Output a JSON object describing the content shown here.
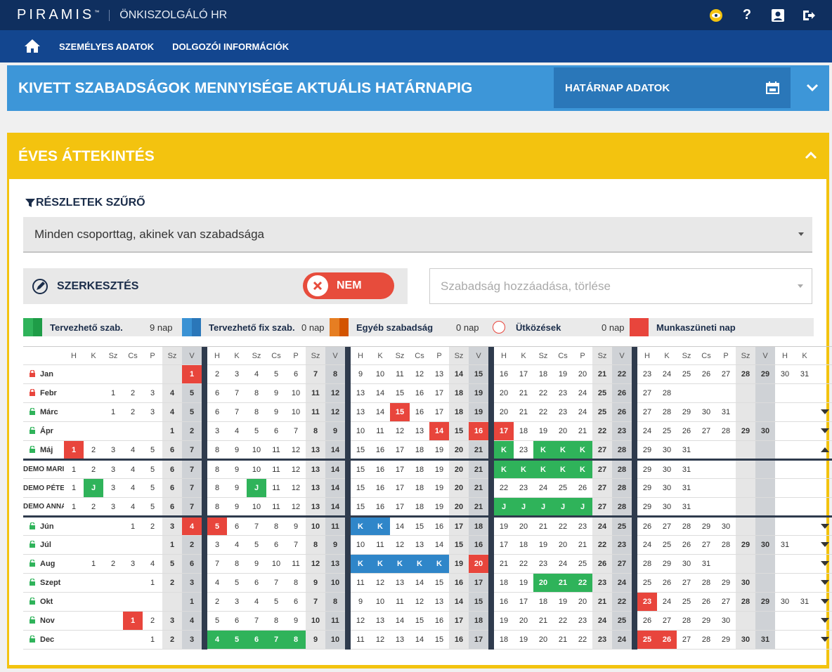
{
  "header": {
    "logo": "PIRAMIS",
    "logo_tm": "™",
    "app_name": "ÖNKISZOLGÁLÓ HR"
  },
  "nav": {
    "items": [
      "SZEMÉLYES ADATOK",
      "DOLGOZÓI INFORMÁCIÓK"
    ]
  },
  "panel1": {
    "title": "KIVETT SZABADSÁGOK MENNYISÉGE AKTUÁLIS HATÁRNAPIG",
    "button": "HATÁRNAP ADATOK"
  },
  "panel2": {
    "title": "ÉVES ÁTTEKINTÉS",
    "filter_title": "RÉSZLETEK SZŰRŐ",
    "filter_value": "Minden csoporttag, akinek van szabadsága",
    "edit_label": "SZERKESZTÉS",
    "toggle_label": "NEM",
    "add_placeholder": "Szabadság hozzáadása, törlése"
  },
  "colors": {
    "green": "#2fb35a",
    "blue": "#2f86c9",
    "orange": "#e67e22",
    "red": "#e8453c"
  },
  "legend": [
    {
      "label": "Tervezhető szab.",
      "count": "9 nap",
      "colors": [
        "#2fb35a",
        "#1e9c47"
      ]
    },
    {
      "label": "Tervezhető fix szab.",
      "count": "0 nap",
      "colors": [
        "#3a92d4",
        "#2a77b9"
      ]
    },
    {
      "label": "Egyéb szabadság",
      "count": "0 nap",
      "colors": [
        "#e67e22",
        "#d35400"
      ]
    },
    {
      "label": "Ütközések",
      "count": "0 nap",
      "type": "circle"
    },
    {
      "label": "Munkaszüneti nap",
      "count": "",
      "colors": [
        "#e8453c",
        "#e8453c"
      ]
    }
  ],
  "day_headers": [
    "H",
    "K",
    "Sz",
    "Cs",
    "P",
    "Sz",
    "V",
    "H",
    "K",
    "Sz",
    "Cs",
    "P",
    "Sz",
    "V",
    "H",
    "K",
    "Sz",
    "Cs",
    "P",
    "Sz",
    "V",
    "H",
    "K",
    "Sz",
    "Cs",
    "P",
    "Sz",
    "V",
    "H",
    "K",
    "Sz",
    "Cs",
    "P",
    "Sz",
    "V",
    "H",
    "K"
  ],
  "rows": [
    {
      "label": "Jan",
      "lock": "closed",
      "action": "",
      "cells": [
        "",
        "",
        "",
        "",
        "",
        "",
        "1",
        "2",
        "3",
        "4",
        "5",
        "6",
        "7",
        "8",
        "9",
        "10",
        "11",
        "12",
        "13",
        "14",
        "15",
        "16",
        "17",
        "18",
        "19",
        "20",
        "21",
        "22",
        "23",
        "24",
        "25",
        "26",
        "27",
        "28",
        "29",
        "30",
        "31"
      ],
      "special": {
        "6": "red"
      }
    },
    {
      "label": "Febr",
      "lock": "closed",
      "action": "",
      "cells": [
        "",
        "",
        "1",
        "2",
        "3",
        "4",
        "5",
        "6",
        "7",
        "8",
        "9",
        "10",
        "11",
        "12",
        "13",
        "14",
        "15",
        "16",
        "17",
        "18",
        "19",
        "20",
        "21",
        "22",
        "23",
        "24",
        "25",
        "26",
        "27",
        "28",
        "",
        "",
        "",
        "",
        "",
        "",
        ""
      ],
      "special": {}
    },
    {
      "label": "Márc",
      "lock": "open",
      "action": "down",
      "cells": [
        "",
        "",
        "1",
        "2",
        "3",
        "4",
        "5",
        "6",
        "7",
        "8",
        "9",
        "10",
        "11",
        "12",
        "13",
        "14",
        "15",
        "16",
        "17",
        "18",
        "19",
        "20",
        "21",
        "22",
        "23",
        "24",
        "25",
        "26",
        "27",
        "28",
        "29",
        "30",
        "31",
        "",
        "",
        "",
        ""
      ],
      "special": {
        "16": "red"
      }
    },
    {
      "label": "Ápr",
      "lock": "open",
      "action": "down",
      "cells": [
        "",
        "",
        "",
        "",
        "",
        "1",
        "2",
        "3",
        "4",
        "5",
        "6",
        "7",
        "8",
        "9",
        "10",
        "11",
        "12",
        "13",
        "14",
        "15",
        "16",
        "17",
        "18",
        "19",
        "20",
        "21",
        "22",
        "23",
        "24",
        "25",
        "26",
        "27",
        "28",
        "29",
        "30",
        "",
        ""
      ],
      "special": {
        "18": "red",
        "20": "red",
        "21": "red"
      }
    },
    {
      "label": "Máj",
      "lock": "open",
      "action": "up",
      "cells": [
        "1",
        "2",
        "3",
        "4",
        "5",
        "6",
        "7",
        "8",
        "9",
        "10",
        "11",
        "12",
        "13",
        "14",
        "15",
        "16",
        "17",
        "18",
        "19",
        "20",
        "21",
        "K",
        "23",
        "K",
        "K",
        "K",
        "27",
        "28",
        "29",
        "30",
        "31",
        "",
        "",
        "",
        "",
        "",
        ""
      ],
      "special": {
        "0": "red",
        "21": "green",
        "23": "green",
        "24": "green",
        "25": "green"
      }
    },
    {
      "label": "DEMO MARI",
      "lock": "",
      "action": "",
      "person": true,
      "cells": [
        "1",
        "2",
        "3",
        "4",
        "5",
        "6",
        "7",
        "8",
        "9",
        "10",
        "11",
        "12",
        "13",
        "14",
        "15",
        "16",
        "17",
        "18",
        "19",
        "20",
        "21",
        "K",
        "K",
        "K",
        "K",
        "K",
        "27",
        "28",
        "29",
        "30",
        "31",
        "",
        "",
        "",
        "",
        "",
        ""
      ],
      "special": {
        "21": "green",
        "22": "green",
        "23": "green",
        "24": "green",
        "25": "green"
      }
    },
    {
      "label": "DEMO PÉTE",
      "lock": "",
      "action": "",
      "person": true,
      "cells": [
        "1",
        "J",
        "3",
        "4",
        "5",
        "6",
        "7",
        "8",
        "9",
        "J",
        "11",
        "12",
        "13",
        "14",
        "15",
        "16",
        "17",
        "18",
        "19",
        "20",
        "21",
        "22",
        "23",
        "24",
        "25",
        "26",
        "27",
        "28",
        "29",
        "30",
        "31",
        "",
        "",
        "",
        "",
        "",
        ""
      ],
      "special": {
        "1": "green",
        "9": "green"
      }
    },
    {
      "label": "DEMO ANNA",
      "lock": "",
      "action": "",
      "person": true,
      "cells": [
        "1",
        "2",
        "3",
        "4",
        "5",
        "6",
        "7",
        "8",
        "9",
        "10",
        "11",
        "12",
        "13",
        "14",
        "15",
        "16",
        "17",
        "18",
        "19",
        "20",
        "21",
        "J",
        "J",
        "J",
        "J",
        "J",
        "27",
        "28",
        "29",
        "30",
        "31",
        "",
        "",
        "",
        "",
        "",
        ""
      ],
      "special": {
        "21": "green",
        "22": "green",
        "23": "green",
        "24": "green",
        "25": "green"
      }
    },
    {
      "label": "Jún",
      "lock": "open",
      "action": "down",
      "thick": true,
      "cells": [
        "",
        "",
        "",
        "1",
        "2",
        "3",
        "4",
        "5",
        "6",
        "7",
        "8",
        "9",
        "10",
        "11",
        "K",
        "K",
        "14",
        "15",
        "16",
        "17",
        "18",
        "19",
        "20",
        "21",
        "22",
        "23",
        "24",
        "25",
        "26",
        "27",
        "28",
        "29",
        "30",
        "",
        "",
        "",
        ""
      ],
      "special": {
        "6": "red",
        "7": "red",
        "14": "blue",
        "15": "blue"
      }
    },
    {
      "label": "Júl",
      "lock": "open",
      "action": "down",
      "cells": [
        "",
        "",
        "",
        "",
        "",
        "1",
        "2",
        "3",
        "4",
        "5",
        "6",
        "7",
        "8",
        "9",
        "10",
        "11",
        "12",
        "13",
        "14",
        "15",
        "16",
        "17",
        "18",
        "19",
        "20",
        "21",
        "22",
        "23",
        "24",
        "25",
        "26",
        "27",
        "28",
        "29",
        "30",
        "31",
        ""
      ],
      "special": {}
    },
    {
      "label": "Aug",
      "lock": "open",
      "action": "down",
      "cells": [
        "",
        "1",
        "2",
        "3",
        "4",
        "5",
        "6",
        "7",
        "8",
        "9",
        "10",
        "11",
        "12",
        "13",
        "K",
        "K",
        "K",
        "K",
        "K",
        "19",
        "20",
        "21",
        "22",
        "23",
        "24",
        "25",
        "26",
        "27",
        "28",
        "29",
        "30",
        "31",
        "",
        "",
        "",
        "",
        ""
      ],
      "special": {
        "14": "blue",
        "15": "blue",
        "16": "blue",
        "17": "blue",
        "18": "blue",
        "20": "red"
      }
    },
    {
      "label": "Szept",
      "lock": "open",
      "action": "down",
      "cells": [
        "",
        "",
        "",
        "",
        "1",
        "2",
        "3",
        "4",
        "5",
        "6",
        "7",
        "8",
        "9",
        "10",
        "11",
        "12",
        "13",
        "14",
        "15",
        "16",
        "17",
        "18",
        "19",
        "20",
        "21",
        "22",
        "23",
        "24",
        "25",
        "26",
        "27",
        "28",
        "29",
        "30",
        "",
        "",
        ""
      ],
      "special": {
        "23": "green",
        "24": "green",
        "25": "green"
      }
    },
    {
      "label": "Okt",
      "lock": "open",
      "action": "down",
      "cells": [
        "",
        "",
        "",
        "",
        "",
        "",
        "1",
        "2",
        "3",
        "4",
        "5",
        "6",
        "7",
        "8",
        "9",
        "10",
        "11",
        "12",
        "13",
        "14",
        "15",
        "16",
        "17",
        "18",
        "19",
        "20",
        "21",
        "22",
        "23",
        "24",
        "25",
        "26",
        "27",
        "28",
        "29",
        "30",
        "31"
      ],
      "special": {
        "28": "red"
      }
    },
    {
      "label": "Nov",
      "lock": "open",
      "action": "down",
      "cells": [
        "",
        "",
        "",
        "1",
        "2",
        "3",
        "4",
        "5",
        "6",
        "7",
        "8",
        "9",
        "10",
        "11",
        "12",
        "13",
        "14",
        "15",
        "16",
        "17",
        "18",
        "19",
        "20",
        "21",
        "22",
        "23",
        "24",
        "25",
        "26",
        "27",
        "28",
        "29",
        "30",
        "",
        "",
        "",
        ""
      ],
      "special": {
        "3": "red"
      }
    },
    {
      "label": "Dec",
      "lock": "open",
      "action": "down",
      "cells": [
        "",
        "",
        "",
        "",
        "1",
        "2",
        "3",
        "4",
        "5",
        "6",
        "7",
        "8",
        "9",
        "10",
        "11",
        "12",
        "13",
        "14",
        "15",
        "16",
        "17",
        "18",
        "19",
        "20",
        "21",
        "22",
        "23",
        "24",
        "25",
        "26",
        "27",
        "28",
        "29",
        "30",
        "31",
        "",
        ""
      ],
      "special": {
        "7": "green",
        "8": "green",
        "9": "green",
        "10": "green",
        "11": "green",
        "28": "red",
        "29": "red"
      }
    }
  ]
}
